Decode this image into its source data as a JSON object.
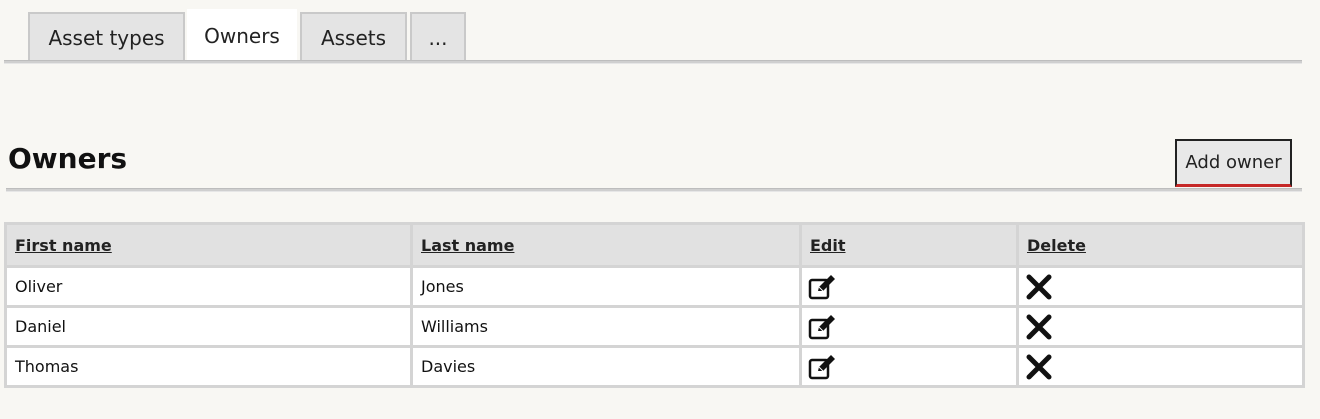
{
  "tabs": [
    {
      "label": "Asset types",
      "active": false
    },
    {
      "label": "Owners",
      "active": true
    },
    {
      "label": "Assets",
      "active": false
    },
    {
      "label": "...",
      "active": false
    }
  ],
  "page": {
    "title": "Owners",
    "add_button_label": "Add owner"
  },
  "table": {
    "columns": [
      "First name",
      "Last name",
      "Edit",
      "Delete"
    ],
    "rows": [
      {
        "first_name": "Oliver",
        "last_name": "Jones",
        "edit_icon": "edit-icon",
        "delete_icon": "delete-icon"
      },
      {
        "first_name": "Daniel",
        "last_name": "Williams",
        "edit_icon": "edit-icon",
        "delete_icon": "delete-icon"
      },
      {
        "first_name": "Thomas",
        "last_name": "Davies",
        "edit_icon": "edit-icon",
        "delete_icon": "delete-icon"
      }
    ]
  },
  "colors": {
    "background": "#f8f7f3",
    "tab_inactive": "#e4e4e4",
    "tab_active": "#ffffff",
    "header_cell": "#e1e1e1",
    "button_accent": "#c62828"
  }
}
